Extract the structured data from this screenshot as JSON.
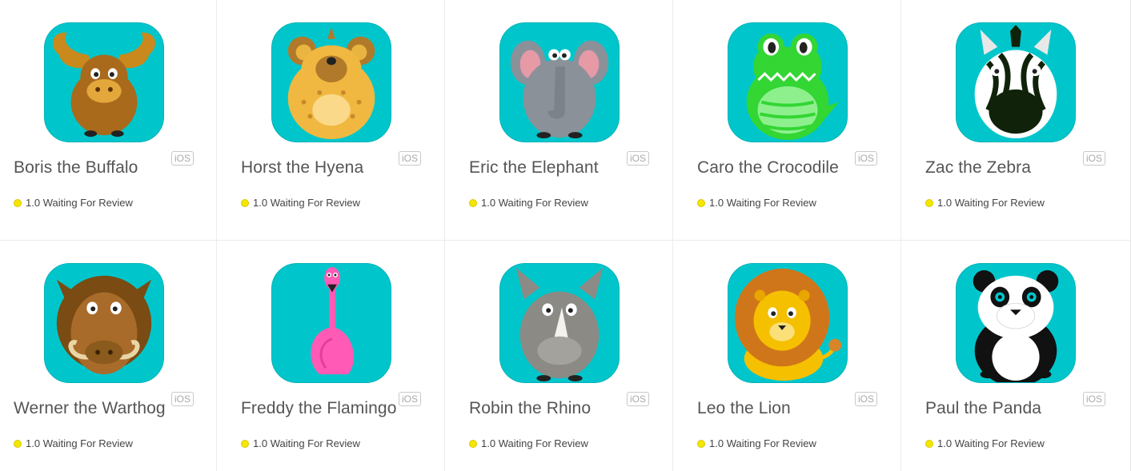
{
  "colors": {
    "icon_background": "#00c6cc",
    "status_waiting": "#f5e600"
  },
  "apps": [
    {
      "name": "Boris the Buffalo",
      "platform": "iOS",
      "version": "1.0",
      "status": "Waiting For Review",
      "icon": "buffalo-icon"
    },
    {
      "name": "Horst the Hyena",
      "platform": "iOS",
      "version": "1.0",
      "status": "Waiting For Review",
      "icon": "hyena-icon"
    },
    {
      "name": "Eric the Elephant",
      "platform": "iOS",
      "version": "1.0",
      "status": "Waiting For Review",
      "icon": "elephant-icon"
    },
    {
      "name": "Caro the Crocodile",
      "platform": "iOS",
      "version": "1.0",
      "status": "Waiting For Review",
      "icon": "crocodile-icon"
    },
    {
      "name": "Zac the Zebra",
      "platform": "iOS",
      "version": "1.0",
      "status": "Waiting For Review",
      "icon": "zebra-icon"
    },
    {
      "name": "Werner the Warthog",
      "platform": "iOS",
      "version": "1.0",
      "status": "Waiting For Review",
      "icon": "warthog-icon"
    },
    {
      "name": "Freddy the Flamingo",
      "platform": "iOS",
      "version": "1.0",
      "status": "Waiting For Review",
      "icon": "flamingo-icon"
    },
    {
      "name": "Robin the Rhino",
      "platform": "iOS",
      "version": "1.0",
      "status": "Waiting For Review",
      "icon": "rhino-icon"
    },
    {
      "name": "Leo the Lion",
      "platform": "iOS",
      "version": "1.0",
      "status": "Waiting For Review",
      "icon": "lion-icon"
    },
    {
      "name": "Paul the Panda",
      "platform": "iOS",
      "version": "1.0",
      "status": "Waiting For Review",
      "icon": "panda-icon"
    }
  ]
}
